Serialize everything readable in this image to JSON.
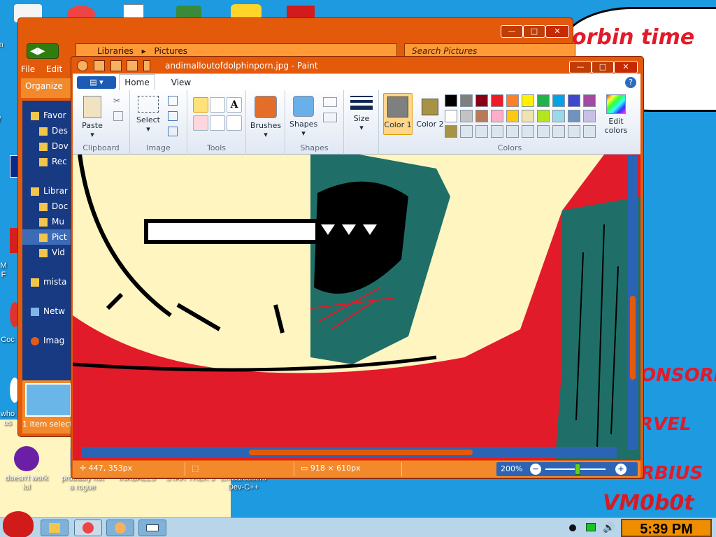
{
  "desktop": {
    "speech_text": "orbin  time",
    "side_texts": [
      "ONSORE",
      "RVEL",
      "RBIUS",
      "VM0b0t"
    ],
    "icons": [
      {
        "label": "m"
      },
      {
        "label": "W"
      },
      {
        "label": "M\nF"
      },
      {
        "label": "Coc"
      },
      {
        "label": "who\nus"
      },
      {
        "label": "doesn't work\nlol"
      },
      {
        "label": "probably not\na rogue"
      },
      {
        "label": "INKBALLS"
      },
      {
        "label": "STAR TREK 3"
      },
      {
        "label": "Embarcadero\nDev-C++"
      }
    ]
  },
  "explorer": {
    "window_buttons": {
      "minimize": "—",
      "maximize": "□",
      "close": "✕"
    },
    "breadcrumb": [
      "Libraries",
      "Pictures"
    ],
    "search_placeholder": "Search Pictures",
    "menu": [
      "File",
      "Edit"
    ],
    "organize_label": "Organize",
    "nav_items": [
      "Favor",
      "Des",
      "Dov",
      "Rec",
      "Librar",
      "Doc",
      "Mu",
      "Pict",
      "Vid",
      "mista",
      "Netw",
      "Imag"
    ],
    "status": "1 item selecte"
  },
  "paint": {
    "title": "andimalloutofdolphinporn.jpg - Paint",
    "window_buttons": {
      "minimize": "—",
      "maximize": "□",
      "close": "✕"
    },
    "tabs": {
      "file": "▤ ▾",
      "home": "Home",
      "view": "View"
    },
    "help": "?",
    "ribbon": {
      "clipboard": {
        "label": "Clipboard",
        "paste": "Paste"
      },
      "image": {
        "label": "Image",
        "select": "Select"
      },
      "tools": {
        "label": "Tools"
      },
      "brushes": {
        "label": "Brushes"
      },
      "shapes": {
        "label": "Shapes",
        "button": "Shapes"
      },
      "size": {
        "label": "Size"
      },
      "colors": {
        "label": "Colors",
        "color1": "Color 1",
        "color2": "Color 2",
        "edit_colors": "Edit colors",
        "color1_value": "#7f7f7f",
        "color2_value": "#a89344",
        "palette_row1": [
          "#000000",
          "#7f7f7f",
          "#880015",
          "#ed1c24",
          "#ff7f27",
          "#fff200",
          "#22b14c",
          "#00a2e8",
          "#3f48cc",
          "#a349a4"
        ],
        "palette_row2": [
          "#ffffff",
          "#c3c3c3",
          "#b97a57",
          "#ffaec9",
          "#ffc90e",
          "#efe4b0",
          "#b5e61d",
          "#99d9ea",
          "#7092be",
          "#c8bfe7"
        ],
        "palette_row3": [
          "#a89344",
          "#dbe5ef",
          "#dbe5ef",
          "#dbe5ef",
          "#dbe5ef",
          "#dbe5ef",
          "#dbe5ef",
          "#dbe5ef",
          "#dbe5ef",
          "#dbe5ef"
        ]
      }
    },
    "status": {
      "cursor_pos": "447, 353px",
      "image_size": "918 × 610px",
      "zoom": "200%"
    }
  },
  "taskbar": {
    "clock": "5:39 PM"
  }
}
